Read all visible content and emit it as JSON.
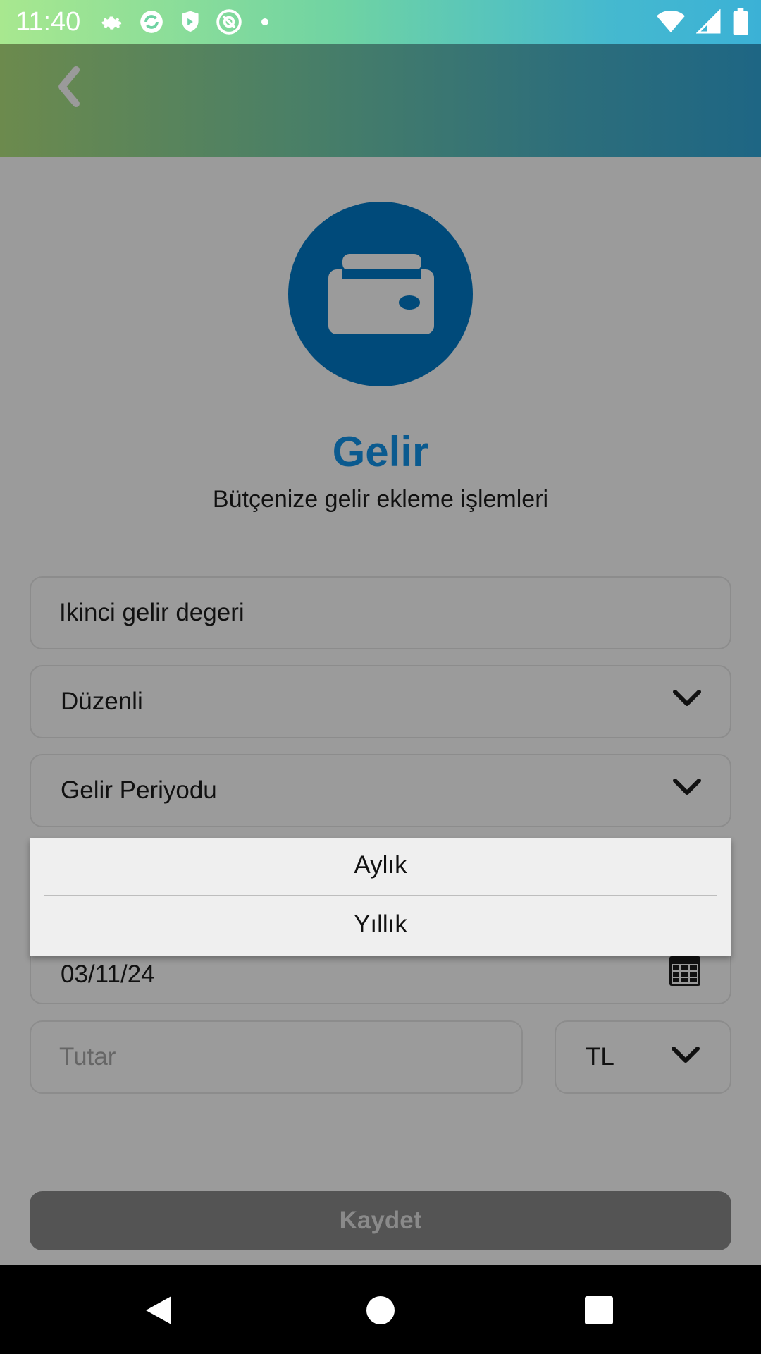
{
  "status_bar": {
    "time": "11:40",
    "icons_left": [
      "settings-icon",
      "sync-icon",
      "shield-icon",
      "at-icon",
      "dot-icon"
    ],
    "icons_right": [
      "wifi-icon",
      "signal-icon",
      "battery-icon"
    ]
  },
  "app_bar": {
    "back_icon": "chevron-left-icon"
  },
  "header": {
    "icon": "wallet-icon",
    "title": "Gelir",
    "subtitle": "Bütçenize gelir ekleme işlemleri"
  },
  "form": {
    "name_value": "Ikinci gelir degeri",
    "type_value": "Düzenli",
    "period_placeholder": "Gelir Periyodu",
    "date_value": "03/11/24",
    "amount_placeholder": "Tutar",
    "currency_value": "TL",
    "save_label": "Kaydet"
  },
  "dropdown": {
    "options": [
      "Aylık",
      "Yıllık"
    ]
  },
  "colors": {
    "accent": "#0a5a8f",
    "hero_circle": "#004a7a",
    "overlay_bg": "#9b9b9b",
    "save_button": "#545454"
  }
}
